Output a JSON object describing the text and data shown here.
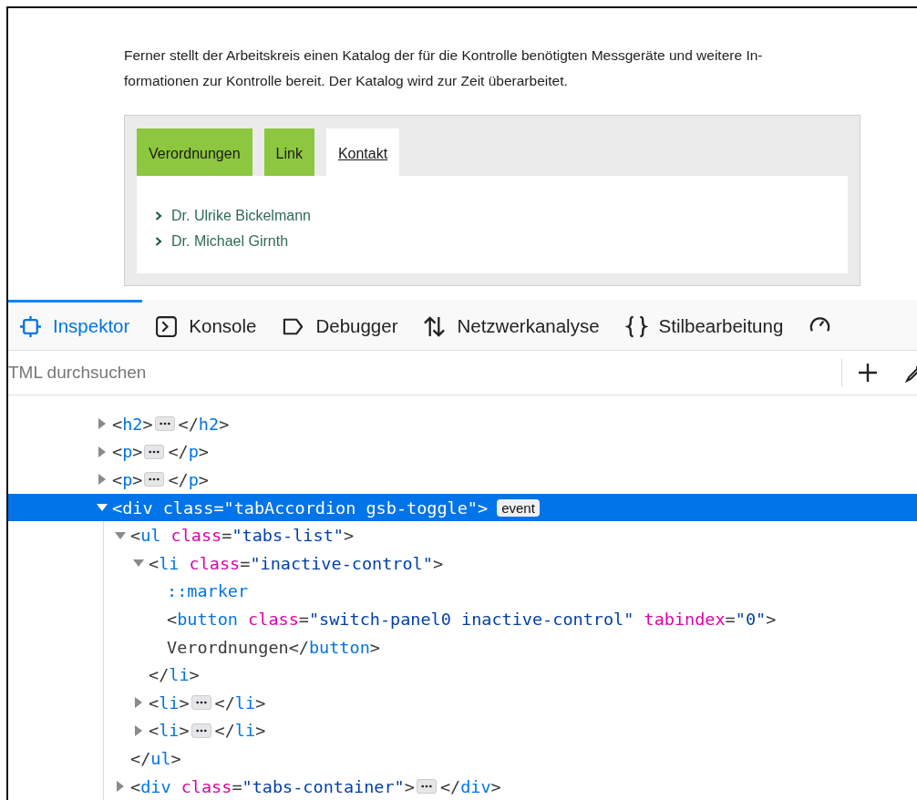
{
  "page": {
    "paragraph_lines": [
      "Ferner stellt der Arbeitskreis einen Katalog der für die Kontrolle benötigten Messgeräte und weitere In-",
      "formationen zur Kontrolle bereit. Der Katalog wird zur Zeit überarbeitet."
    ],
    "tabs": [
      {
        "label": "Verordnungen",
        "selected": false
      },
      {
        "label": "Link",
        "selected": false
      },
      {
        "label": "Kontakt",
        "selected": true
      }
    ],
    "contacts": [
      "Dr. Ulrike Bickelmann",
      "Dr. Michael Girnth"
    ]
  },
  "devtools": {
    "tabs": [
      {
        "label": "Inspektor",
        "selected": true
      },
      {
        "label": "Konsole",
        "selected": false
      },
      {
        "label": "Debugger",
        "selected": false
      },
      {
        "label": "Netzwerkanalyse",
        "selected": false
      },
      {
        "label": "Stilbearbeitung",
        "selected": false
      }
    ],
    "search": {
      "placeholder": "TML durchsuchen"
    },
    "tree": [
      {
        "expanded": false,
        "selected": false,
        "lines": [
          [
            {
              "kind": "punct",
              "text": "<"
            },
            {
              "kind": "tag",
              "text": "h2"
            },
            {
              "kind": "punct",
              "text": ">"
            },
            {
              "kind": "ellipsis"
            },
            {
              "kind": "punct",
              "text": "</"
            },
            {
              "kind": "tag",
              "text": "h2"
            },
            {
              "kind": "punct",
              "text": ">"
            }
          ]
        ]
      },
      {
        "expanded": false,
        "selected": false,
        "lines": [
          [
            {
              "kind": "punct",
              "text": "<"
            },
            {
              "kind": "tag",
              "text": "p"
            },
            {
              "kind": "punct",
              "text": ">"
            },
            {
              "kind": "ellipsis"
            },
            {
              "kind": "punct",
              "text": "</"
            },
            {
              "kind": "tag",
              "text": "p"
            },
            {
              "kind": "punct",
              "text": ">"
            }
          ]
        ]
      },
      {
        "expanded": false,
        "selected": false,
        "lines": [
          [
            {
              "kind": "punct",
              "text": "<"
            },
            {
              "kind": "tag",
              "text": "p"
            },
            {
              "kind": "punct",
              "text": ">"
            },
            {
              "kind": "ellipsis"
            },
            {
              "kind": "punct",
              "text": "</"
            },
            {
              "kind": "tag",
              "text": "p"
            },
            {
              "kind": "punct",
              "text": ">"
            }
          ]
        ]
      },
      {
        "expanded": true,
        "selected": true,
        "badge": "event",
        "lines": [
          [
            {
              "kind": "punct",
              "text": "<"
            },
            {
              "kind": "tag",
              "text": "div"
            },
            {
              "kind": "attr",
              "text": " class"
            },
            {
              "kind": "punct",
              "text": "="
            },
            {
              "kind": "value",
              "text": "\"tabAccordion gsb-toggle\""
            },
            {
              "kind": "punct",
              "text": ">"
            }
          ]
        ],
        "children": [
          {
            "expanded": true,
            "selected": false,
            "lines": [
              [
                {
                  "kind": "punct",
                  "text": "<"
                },
                {
                  "kind": "tag",
                  "text": "ul"
                },
                {
                  "kind": "attr",
                  "text": " class"
                },
                {
                  "kind": "punct",
                  "text": "="
                },
                {
                  "kind": "value",
                  "text": "\"tabs-list\""
                },
                {
                  "kind": "punct",
                  "text": ">"
                }
              ]
            ],
            "children": [
              {
                "expanded": true,
                "selected": false,
                "lines": [
                  [
                    {
                      "kind": "punct",
                      "text": "<"
                    },
                    {
                      "kind": "tag",
                      "text": "li"
                    },
                    {
                      "kind": "attr",
                      "text": " class"
                    },
                    {
                      "kind": "punct",
                      "text": "="
                    },
                    {
                      "kind": "value",
                      "text": "\"inactive-control\""
                    },
                    {
                      "kind": "punct",
                      "text": ">"
                    }
                  ]
                ],
                "children": [
                  {
                    "selected": false,
                    "lines": [
                      [
                        {
                          "kind": "pseudo",
                          "text": "::marker"
                        }
                      ]
                    ]
                  },
                  {
                    "selected": false,
                    "lines": [
                      [
                        {
                          "kind": "punct",
                          "text": "<"
                        },
                        {
                          "kind": "tag",
                          "text": "button"
                        },
                        {
                          "kind": "attr",
                          "text": " class"
                        },
                        {
                          "kind": "punct",
                          "text": "="
                        },
                        {
                          "kind": "value",
                          "text": "\"switch-panel0 inactive-control\""
                        },
                        {
                          "kind": "attr",
                          "text": " tabindex"
                        },
                        {
                          "kind": "punct",
                          "text": "="
                        },
                        {
                          "kind": "value",
                          "text": "\"0\""
                        },
                        {
                          "kind": "punct",
                          "text": ">"
                        }
                      ],
                      [
                        {
                          "kind": "text",
                          "text": "Verordnungen"
                        },
                        {
                          "kind": "punct",
                          "text": "</"
                        },
                        {
                          "kind": "tag",
                          "text": "button"
                        },
                        {
                          "kind": "punct",
                          "text": ">"
                        }
                      ]
                    ]
                  }
                ],
                "closing": [
                  {
                    "kind": "punct",
                    "text": "</"
                  },
                  {
                    "kind": "tag",
                    "text": "li"
                  },
                  {
                    "kind": "punct",
                    "text": ">"
                  }
                ]
              },
              {
                "expanded": false,
                "selected": false,
                "lines": [
                  [
                    {
                      "kind": "punct",
                      "text": "<"
                    },
                    {
                      "kind": "tag",
                      "text": "li"
                    },
                    {
                      "kind": "punct",
                      "text": ">"
                    },
                    {
                      "kind": "ellipsis"
                    },
                    {
                      "kind": "punct",
                      "text": "</"
                    },
                    {
                      "kind": "tag",
                      "text": "li"
                    },
                    {
                      "kind": "punct",
                      "text": ">"
                    }
                  ]
                ]
              },
              {
                "expanded": false,
                "selected": false,
                "lines": [
                  [
                    {
                      "kind": "punct",
                      "text": "<"
                    },
                    {
                      "kind": "tag",
                      "text": "li"
                    },
                    {
                      "kind": "punct",
                      "text": ">"
                    },
                    {
                      "kind": "ellipsis"
                    },
                    {
                      "kind": "punct",
                      "text": "</"
                    },
                    {
                      "kind": "tag",
                      "text": "li"
                    },
                    {
                      "kind": "punct",
                      "text": ">"
                    }
                  ]
                ]
              }
            ],
            "closing": [
              {
                "kind": "punct",
                "text": "</"
              },
              {
                "kind": "tag",
                "text": "ul"
              },
              {
                "kind": "punct",
                "text": ">"
              }
            ]
          },
          {
            "expanded": false,
            "selected": false,
            "lines": [
              [
                {
                  "kind": "punct",
                  "text": "<"
                },
                {
                  "kind": "tag",
                  "text": "div"
                },
                {
                  "kind": "attr",
                  "text": " class"
                },
                {
                  "kind": "punct",
                  "text": "="
                },
                {
                  "kind": "value",
                  "text": "\"tabs-container\""
                },
                {
                  "kind": "punct",
                  "text": ">"
                },
                {
                  "kind": "ellipsis"
                },
                {
                  "kind": "punct",
                  "text": "</"
                },
                {
                  "kind": "tag",
                  "text": "div"
                },
                {
                  "kind": "punct",
                  "text": ">"
                }
              ]
            ]
          }
        ]
      }
    ]
  }
}
